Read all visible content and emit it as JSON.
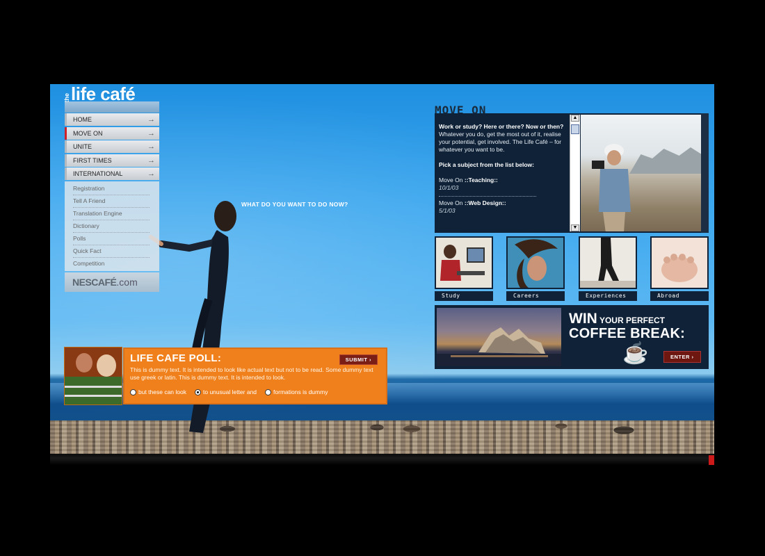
{
  "logo": {
    "the": "the",
    "main": "life café"
  },
  "nav": {
    "main": [
      {
        "label": "HOME",
        "active": false
      },
      {
        "label": "MOVE ON",
        "active": true
      },
      {
        "label": "UNITE",
        "active": false
      },
      {
        "label": "FIRST TIMES",
        "active": false
      },
      {
        "label": "INTERNATIONAL",
        "active": false
      }
    ],
    "sub": [
      "Registration",
      "Tell A Friend",
      "Translation Engine",
      "Dictionary",
      "Polls",
      "Quick Fact",
      "Competition"
    ],
    "brand": {
      "bold": "NESCAFÉ",
      "rest": ".com"
    }
  },
  "tagline": "WHAT DO YOU WANT TO DO NOW?",
  "poll": {
    "title": "LIFE CAFE POLL:",
    "text": "This is dummy text. It is intended to look like actual text but not to be read. Some dummy text use greek or latin. This is dummy text. It is intended to look.",
    "submit": "SUBMIT ›",
    "options": [
      {
        "label": "but these can look",
        "selected": false
      },
      {
        "label": "to unusual letter and",
        "selected": true
      },
      {
        "label": "formations is dummy",
        "selected": false
      }
    ]
  },
  "move_on": {
    "title": "MOVE ON",
    "intro_bold": "Work or study? Here or there? Now or then?",
    "intro_text": "Whatever you do, get the most out of it, realise your potential, get involved. The Life Café – for whatever you want to be.",
    "prompt": "Pick a subject from the list below:",
    "entries": [
      {
        "prefix": "Move On ",
        "subject": "::Teaching::",
        "date": "10/1/03"
      },
      {
        "prefix": "Move On ",
        "subject": "::Web Design::",
        "date": "5/1/03"
      }
    ],
    "scroll_up": "▲",
    "scroll_down": "▼"
  },
  "categories": [
    "Study",
    "Careers",
    "Experiences",
    "Abroad"
  ],
  "promo": {
    "win": "WIN",
    "win_rest": " YOUR PERFECT",
    "line2": "COFFEE BREAK:",
    "enter": "ENTER ›"
  },
  "colors": {
    "navy": "#0f2238",
    "orange": "#f0801c",
    "accent_red": "#d0202a"
  }
}
